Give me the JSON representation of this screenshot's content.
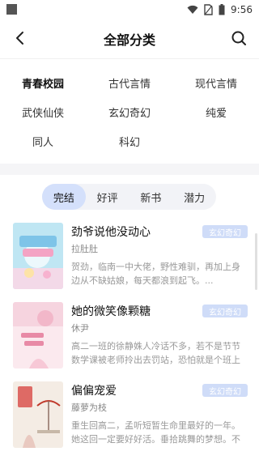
{
  "status": {
    "time": "9:56"
  },
  "nav": {
    "title": "全部分类"
  },
  "categories": [
    "青春校园",
    "古代言情",
    "现代言情",
    "武侠仙侠",
    "玄幻奇幻",
    "纯爱",
    "同人",
    "科幻"
  ],
  "tabs": [
    "完结",
    "好评",
    "新书",
    "潜力"
  ],
  "books": [
    {
      "title": "劲爷说他没动心",
      "author": "拉肚肚",
      "tag": "玄幻奇幻",
      "desc": "贺劲，临南一中大佬，野性难驯，再加上身边从不缺姑娘，每天都浪到起飞。..."
    },
    {
      "title": "她的微笑像颗糖",
      "author": "休尹",
      "tag": "玄幻奇幻",
      "desc": "高二一班的徐静姝人冷话不多，若不是节节数学课被老师拎出去罚站，恐怕就是个班上的..."
    },
    {
      "title": "偏偏宠爱",
      "author": "藤萝为枝",
      "tag": "玄幻奇幻",
      "desc": "重生回高二，孟听短暂生命里最好的一年。她这回一定要好好活。垂拾跳舞的梦想。不再..."
    }
  ],
  "colors": {
    "accent": "#4a7bd8",
    "tab_active_bg": "#d4e0fb",
    "tag_bg": "#cfdcf8"
  }
}
